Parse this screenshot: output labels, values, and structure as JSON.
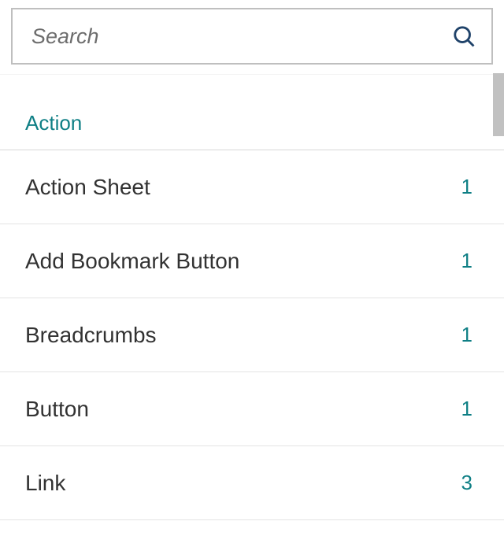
{
  "search": {
    "placeholder": "Search",
    "value": ""
  },
  "group": {
    "title": "Action",
    "items": [
      {
        "label": "Action Sheet",
        "count": "1"
      },
      {
        "label": "Add Bookmark Button",
        "count": "1"
      },
      {
        "label": "Breadcrumbs",
        "count": "1"
      },
      {
        "label": "Button",
        "count": "1"
      },
      {
        "label": "Link",
        "count": "3"
      }
    ]
  }
}
